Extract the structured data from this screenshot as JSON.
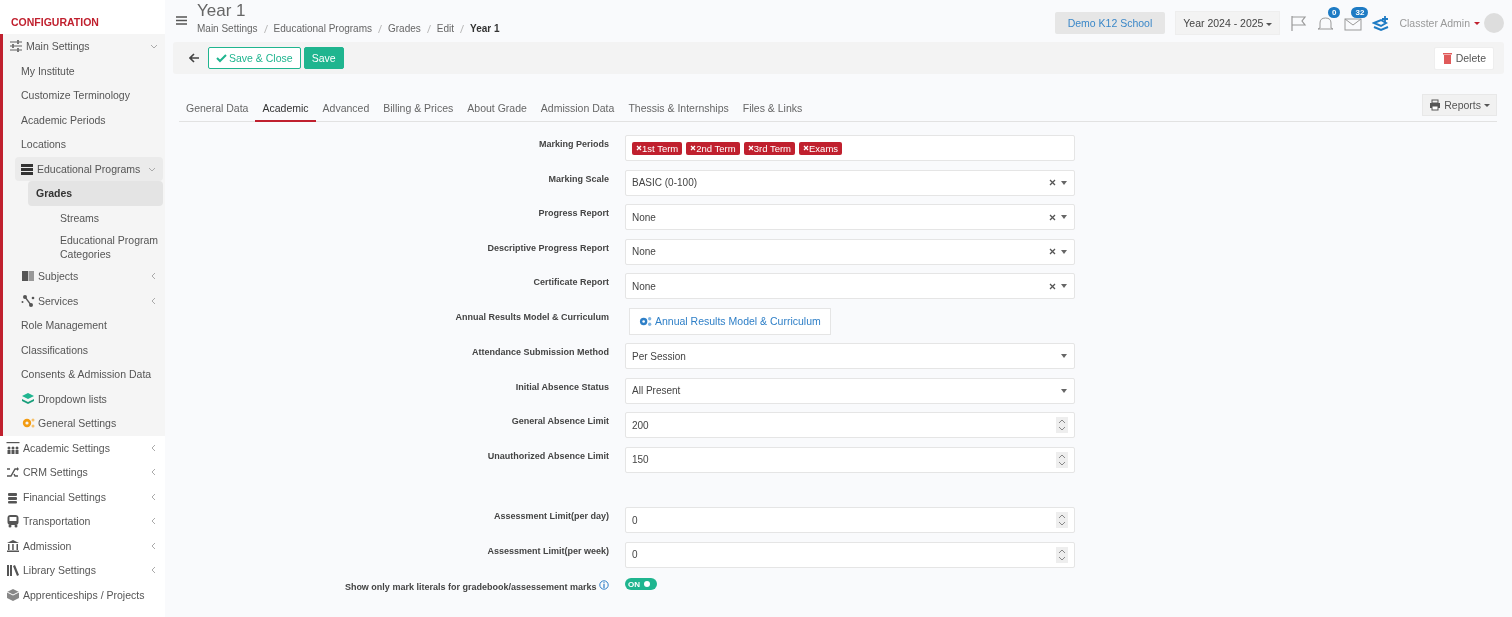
{
  "sidebar": {
    "heading": "CONFIGURATION",
    "items": [
      {
        "label": "Main Settings",
        "expanded": true,
        "children": [
          {
            "label": "My Institute"
          },
          {
            "label": "Customize Terminology"
          },
          {
            "label": "Academic Periods"
          },
          {
            "label": "Locations"
          },
          {
            "label": "Educational Programs",
            "expanded": true,
            "children": [
              {
                "label": "Grades",
                "selected": true
              },
              {
                "label": "Streams",
                "selected": false
              },
              {
                "label": "Educational Program Categories",
                "selected": false
              }
            ]
          },
          {
            "label": "Subjects",
            "expanded": false
          },
          {
            "label": "Services",
            "expanded": false
          },
          {
            "label": "Role Management"
          },
          {
            "label": "Classifications"
          },
          {
            "label": "Consents & Admission Data"
          },
          {
            "label": "Dropdown lists"
          },
          {
            "label": "General Settings"
          }
        ]
      },
      {
        "label": "Academic Settings",
        "expanded": false
      },
      {
        "label": "CRM Settings",
        "expanded": false
      },
      {
        "label": "Financial Settings",
        "expanded": false
      },
      {
        "label": "Transportation",
        "expanded": false
      },
      {
        "label": "Admission",
        "expanded": false
      },
      {
        "label": "Library Settings",
        "expanded": false
      },
      {
        "label": "Apprenticeships / Projects"
      }
    ]
  },
  "header": {
    "title": "Year 1",
    "breadcrumb": [
      "Main Settings",
      "Educational Programs",
      "Grades",
      "Edit",
      "Year 1"
    ],
    "school": "Demo K12 School",
    "year": "Year 2024 - 2025",
    "notifications": "0",
    "messages": "32",
    "user": "Classter Admin"
  },
  "toolbar": {
    "save_close": "Save & Close",
    "save": "Save",
    "delete": "Delete"
  },
  "tabs": [
    {
      "label": "General Data",
      "selected": false
    },
    {
      "label": "Academic",
      "selected": true
    },
    {
      "label": "Advanced",
      "selected": false
    },
    {
      "label": "Billing & Prices",
      "selected": false
    },
    {
      "label": "About Grade",
      "selected": false
    },
    {
      "label": "Admission Data",
      "selected": false
    },
    {
      "label": "Thessis & Internships",
      "selected": false
    },
    {
      "label": "Files & Links",
      "selected": false
    }
  ],
  "reports": "Reports",
  "fields": [
    {
      "kind": "tags",
      "label": "Marking Periods",
      "tags": [
        "1st Term",
        "2nd Term",
        "3rd Term",
        "Exams"
      ]
    },
    {
      "kind": "select",
      "label": "Marking Scale",
      "value": "BASIC (0-100)",
      "clearable": true
    },
    {
      "kind": "select",
      "label": "Progress Report",
      "value": "None",
      "clearable": true
    },
    {
      "kind": "select",
      "label": "Descriptive Progress Report",
      "value": "None",
      "clearable": true
    },
    {
      "kind": "select",
      "label": "Certificate Report",
      "value": "None",
      "clearable": true
    },
    {
      "kind": "button",
      "label": "Annual Results Model & Curriculum",
      "value": "Annual Results Model & Curriculum"
    },
    {
      "kind": "select",
      "label": "Attendance Submission Method",
      "value": "Per Session",
      "clearable": false
    },
    {
      "kind": "select",
      "label": "Initial Absence Status",
      "value": "All Present",
      "clearable": false
    },
    {
      "kind": "number",
      "label": "General Absence Limit",
      "value": "200"
    },
    {
      "kind": "number",
      "label": "Unauthorized Absence Limit",
      "value": "150"
    },
    {
      "kind": "number",
      "label": "Assessment Limit(per day)",
      "value": "0"
    },
    {
      "kind": "number",
      "label": "Assessment Limit(per week)",
      "value": "0"
    },
    {
      "kind": "toggle",
      "label": "Show only mark literals for gradebook/assessement marks",
      "info": true,
      "on": true,
      "text": "ON"
    }
  ]
}
